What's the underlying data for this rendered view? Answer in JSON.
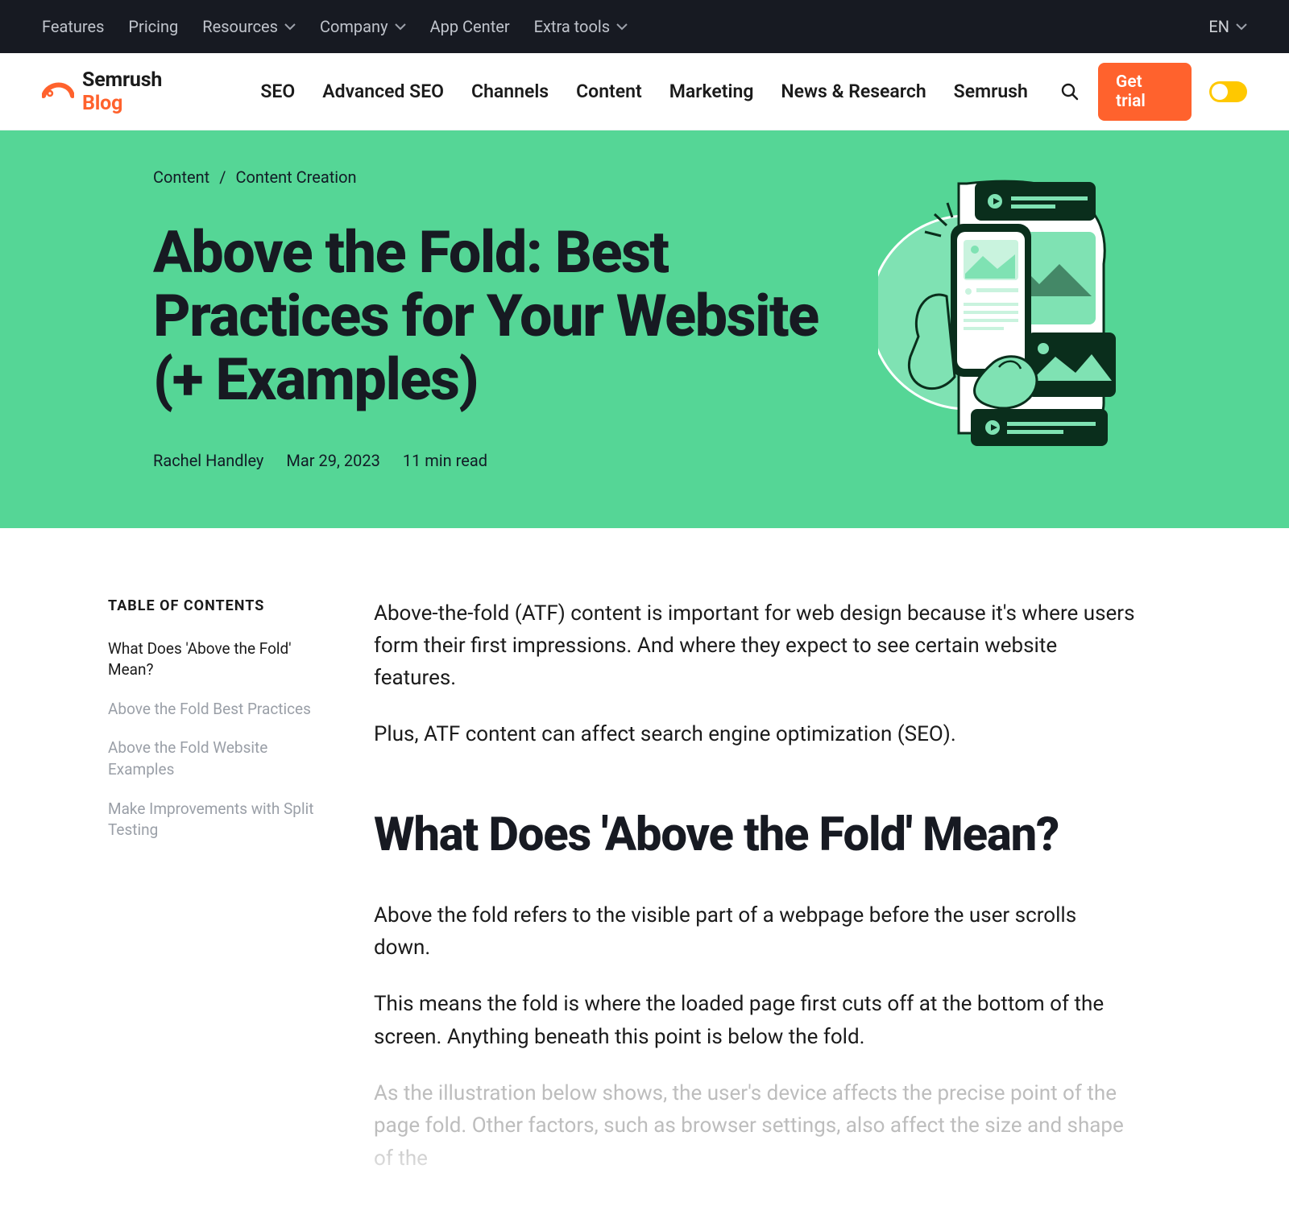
{
  "topnav": {
    "items": [
      "Features",
      "Pricing",
      "Resources",
      "Company",
      "App Center",
      "Extra tools"
    ],
    "lang": "EN"
  },
  "mainnav": {
    "brand_name": "Semrush",
    "brand_suffix": "Blog",
    "items": [
      "SEO",
      "Advanced SEO",
      "Channels",
      "Content",
      "Marketing",
      "News & Research",
      "Semrush"
    ],
    "cta": "Get trial"
  },
  "breadcrumb": {
    "items": [
      "Content",
      "Content Creation"
    ]
  },
  "hero": {
    "title": "Above the Fold: Best Practices for Your Website (+ Examples)",
    "author": "Rachel Handley",
    "date": "Mar 29, 2023",
    "readtime": "11 min read"
  },
  "toc": {
    "title": "TABLE OF CONTENTS",
    "items": [
      {
        "label": "What Does 'Above the Fold' Mean?",
        "active": true
      },
      {
        "label": "Above the Fold Best Practices",
        "active": false
      },
      {
        "label": "Above the Fold Website Examples",
        "active": false
      },
      {
        "label": "Make Improvements with Split Testing",
        "active": false
      }
    ]
  },
  "article": {
    "p1": "Above-the-fold (ATF) content is important for web design because it's where users form their first impressions. And where they expect to see certain website features.",
    "p2": "Plus, ATF content can affect search engine optimization (SEO).",
    "h2": "What Does 'Above the Fold' Mean?",
    "p3": "Above the fold refers to the visible part of a webpage before the user scrolls down.",
    "p4": "This means the fold is where the loaded page first cuts off at the bottom of the screen. Anything beneath this point is below the fold.",
    "p5": "As the illustration below shows, the user's device affects the precise point of the page fold. Other factors, such as browser settings, also affect the size and shape of the"
  }
}
